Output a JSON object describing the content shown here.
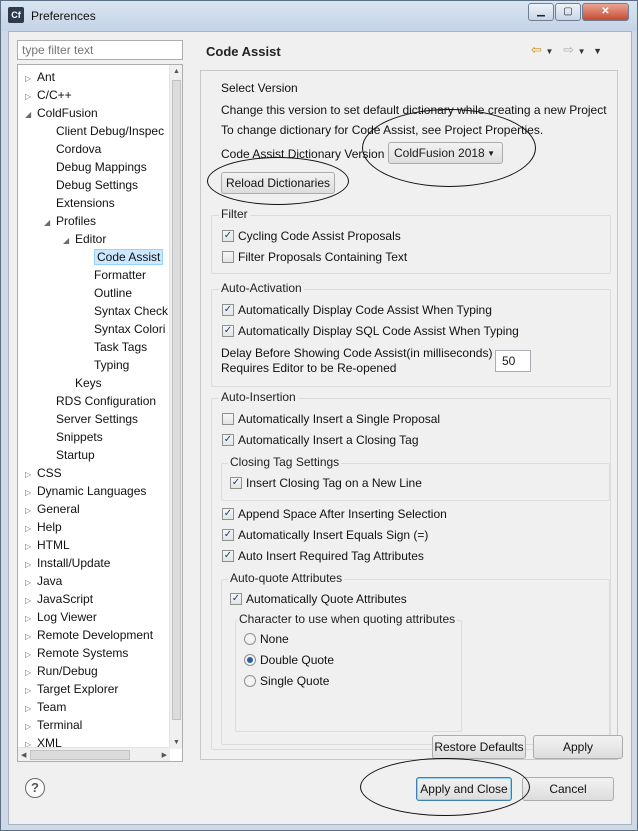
{
  "window": {
    "title": "Preferences",
    "app_icon": "Cf"
  },
  "filter": {
    "placeholder": "type filter text"
  },
  "tree": [
    {
      "label": "Ant",
      "indent": 0,
      "arrow": "▷"
    },
    {
      "label": "C/C++",
      "indent": 0,
      "arrow": "▷"
    },
    {
      "label": "ColdFusion",
      "indent": 0,
      "arrow": "◢"
    },
    {
      "label": "Client Debug/Inspec",
      "indent": 1,
      "arrow": ""
    },
    {
      "label": "Cordova",
      "indent": 1,
      "arrow": ""
    },
    {
      "label": "Debug Mappings",
      "indent": 1,
      "arrow": ""
    },
    {
      "label": "Debug Settings",
      "indent": 1,
      "arrow": ""
    },
    {
      "label": "Extensions",
      "indent": 1,
      "arrow": ""
    },
    {
      "label": "Profiles",
      "indent": 1,
      "arrow": "◢"
    },
    {
      "label": "Editor",
      "indent": 2,
      "arrow": "◢"
    },
    {
      "label": "Code Assist",
      "indent": 3,
      "arrow": "",
      "selected": true
    },
    {
      "label": "Formatter",
      "indent": 3,
      "arrow": ""
    },
    {
      "label": "Outline",
      "indent": 3,
      "arrow": ""
    },
    {
      "label": "Syntax Check",
      "indent": 3,
      "arrow": ""
    },
    {
      "label": "Syntax Colori",
      "indent": 3,
      "arrow": ""
    },
    {
      "label": "Task Tags",
      "indent": 3,
      "arrow": ""
    },
    {
      "label": "Typing",
      "indent": 3,
      "arrow": ""
    },
    {
      "label": "Keys",
      "indent": 2,
      "arrow": ""
    },
    {
      "label": "RDS Configuration",
      "indent": 1,
      "arrow": ""
    },
    {
      "label": "Server Settings",
      "indent": 1,
      "arrow": ""
    },
    {
      "label": "Snippets",
      "indent": 1,
      "arrow": ""
    },
    {
      "label": "Startup",
      "indent": 1,
      "arrow": ""
    },
    {
      "label": "CSS",
      "indent": 0,
      "arrow": "▷"
    },
    {
      "label": "Dynamic Languages",
      "indent": 0,
      "arrow": "▷"
    },
    {
      "label": "General",
      "indent": 0,
      "arrow": "▷"
    },
    {
      "label": "Help",
      "indent": 0,
      "arrow": "▷"
    },
    {
      "label": "HTML",
      "indent": 0,
      "arrow": "▷"
    },
    {
      "label": "Install/Update",
      "indent": 0,
      "arrow": "▷"
    },
    {
      "label": "Java",
      "indent": 0,
      "arrow": "▷"
    },
    {
      "label": "JavaScript",
      "indent": 0,
      "arrow": "▷"
    },
    {
      "label": "Log Viewer",
      "indent": 0,
      "arrow": "▷"
    },
    {
      "label": "Remote Development",
      "indent": 0,
      "arrow": "▷"
    },
    {
      "label": "Remote Systems",
      "indent": 0,
      "arrow": "▷"
    },
    {
      "label": "Run/Debug",
      "indent": 0,
      "arrow": "▷"
    },
    {
      "label": "Target Explorer",
      "indent": 0,
      "arrow": "▷"
    },
    {
      "label": "Team",
      "indent": 0,
      "arrow": "▷"
    },
    {
      "label": "Terminal",
      "indent": 0,
      "arrow": "▷"
    },
    {
      "label": "XML",
      "indent": 0,
      "arrow": "▷"
    }
  ],
  "page": {
    "title": "Code Assist",
    "select_version": {
      "title": "Select Version",
      "line1": "Change this version to set default dictionary while creating a new Project",
      "line2": "To change dictionary for Code Assist, see Project Properties.",
      "dictionary_label": "Code Assist Dictionary Version",
      "dictionary_value": "ColdFusion 2018",
      "reload_button": "Reload Dictionaries"
    },
    "filter_group": {
      "title": "Filter",
      "cycling": {
        "label": "Cycling Code Assist Proposals",
        "checked": true
      },
      "containing": {
        "label": "Filter Proposals Containing Text",
        "checked": false
      }
    },
    "auto_activation": {
      "title": "Auto-Activation",
      "display_typing": {
        "label": "Automatically Display Code Assist When Typing",
        "checked": true
      },
      "display_sql": {
        "label": "Automatically Display SQL Code Assist When Typing",
        "checked": true
      },
      "delay_label_1": "Delay Before Showing Code Assist(in milliseconds)",
      "delay_label_2": "Requires Editor to be Re-opened",
      "delay_value": "50"
    },
    "auto_insertion": {
      "title": "Auto-Insertion",
      "single_proposal": {
        "label": "Automatically Insert a Single Proposal",
        "checked": false
      },
      "closing_tag": {
        "label": "Automatically Insert a Closing Tag",
        "checked": true
      },
      "closing_tag_settings": {
        "title": "Closing Tag Settings",
        "new_line": {
          "label": "Insert Closing Tag on a New Line",
          "checked": true
        }
      },
      "append_space": {
        "label": "Append Space After Inserting Selection",
        "checked": true
      },
      "equals_sign": {
        "label": "Automatically Insert Equals Sign (=)",
        "checked": true
      },
      "required_attrs": {
        "label": "Auto Insert Required Tag Attributes",
        "checked": true
      },
      "auto_quote": {
        "title": "Auto-quote Attributes",
        "quote_attrs": {
          "label": "Automatically Quote Attributes",
          "checked": true
        },
        "char_label": "Character to use when quoting attributes",
        "options": [
          "None",
          "Double Quote",
          "Single Quote"
        ],
        "selected": "Double Quote"
      }
    },
    "restore_defaults": "Restore Defaults",
    "apply": "Apply"
  },
  "footer": {
    "help_icon": "?",
    "apply_close": "Apply and Close",
    "cancel": "Cancel"
  },
  "check_mark": "✓"
}
